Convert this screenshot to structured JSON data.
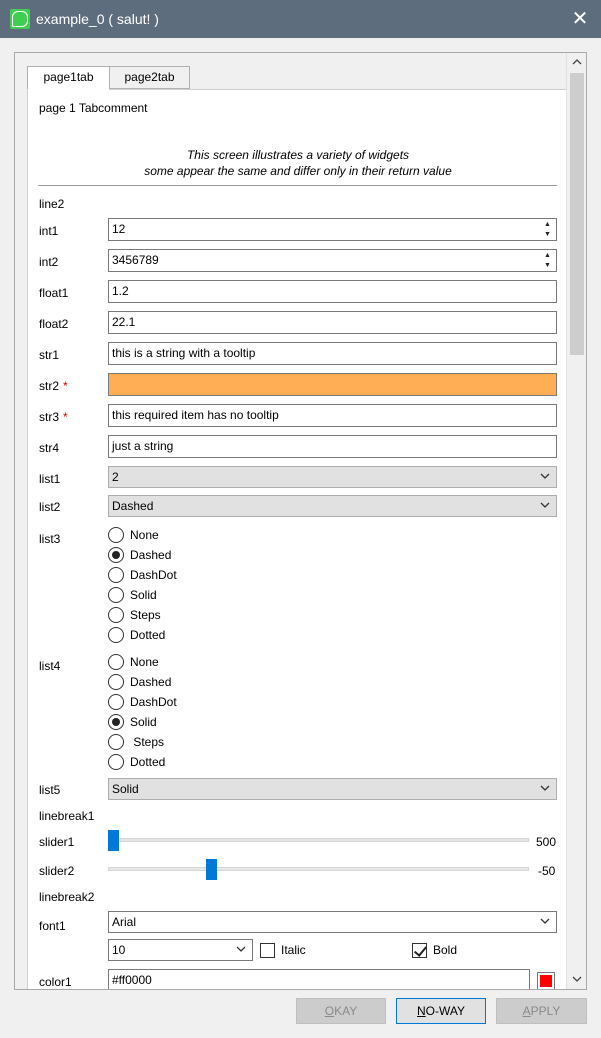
{
  "window": {
    "title": "example_0 ( salut! )"
  },
  "tabs": [
    {
      "label": "page1tab",
      "active": true
    },
    {
      "label": "page2tab",
      "active": false
    }
  ],
  "page": {
    "comment": "page 1 Tabcomment",
    "intro_line1": "This screen illustrates a variety of widgets",
    "intro_line2": "some appear the same and differ only in their return value",
    "line2": "line2"
  },
  "fields": {
    "int1": {
      "label": "int1",
      "value": "12"
    },
    "int2": {
      "label": "int2",
      "value": "3456789"
    },
    "float1": {
      "label": "float1",
      "value": "1.2"
    },
    "float2": {
      "label": "float2",
      "value": "22.1"
    },
    "str1": {
      "label": "str1",
      "value": "this is a string with a tooltip"
    },
    "str2": {
      "label": "str2",
      "required": "*",
      "value": ""
    },
    "str3": {
      "label": "str3",
      "required": "*",
      "value": "this required item has no tooltip"
    },
    "str4": {
      "label": "str4",
      "value": "just a string"
    },
    "list1": {
      "label": "list1",
      "value": "2"
    },
    "list2": {
      "label": "list2",
      "value": "Dashed"
    },
    "list3": {
      "label": "list3",
      "options": [
        "None",
        "Dashed",
        "DashDot",
        "Solid",
        "Steps",
        "Dotted"
      ],
      "selected": "Dashed"
    },
    "list4": {
      "label": "list4",
      "options": [
        "None",
        "Dashed",
        "DashDot",
        "Solid",
        " Steps",
        "Dotted"
      ],
      "selected": "Solid"
    },
    "list5": {
      "label": "list5",
      "value": "Solid"
    },
    "linebreak1": "linebreak1",
    "slider1": {
      "label": "slider1",
      "value": "500",
      "position": 0.0
    },
    "slider2": {
      "label": "slider2",
      "value": "-50",
      "position": 0.24
    },
    "linebreak2": "linebreak2",
    "font1": {
      "label": "font1",
      "family": "Arial",
      "size": "10",
      "italic_label": "Italic",
      "italic": false,
      "bold_label": "Bold",
      "bold": true
    },
    "color1": {
      "label": "color1",
      "value": "#ff0000"
    }
  },
  "buttons": {
    "okay": {
      "label_u": "O",
      "label_rest": "KAY",
      "enabled": false
    },
    "noway": {
      "label_u": "N",
      "label_rest": "O-WAY",
      "enabled": true
    },
    "apply": {
      "label_u": "A",
      "label_rest": "PPLY",
      "enabled": false
    }
  },
  "colors": {
    "titlebar": "#5d6d7e",
    "required_bg": "#ffae55",
    "accent": "#0078d7",
    "swatch": "#ff0000"
  }
}
